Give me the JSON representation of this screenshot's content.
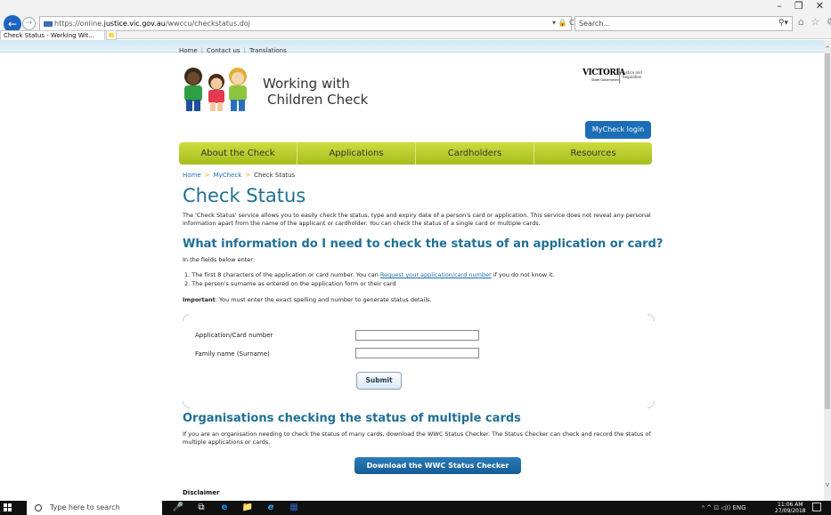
{
  "browser": {
    "url_prefix": "https://online.",
    "url_domain": "justice.vic.gov.au",
    "url_path": "/wwccu/checkstatus.doj",
    "addr_tools": "▾ 🔒 C",
    "search_placeholder": "Search...",
    "tab_title": "Check Status - Working Wit...",
    "window_controls": [
      "–",
      "❐",
      "✕"
    ],
    "toolbar_icons": "⌂ ☆ ⚙ ☺"
  },
  "site": {
    "utility_nav": [
      "Home",
      "Contact us",
      "Translations"
    ],
    "utility_sep": "|",
    "logo_line1": "Working with",
    "logo_line2": "Children Check",
    "vic_word": "VICTORIA",
    "vic_state": "State Government",
    "vic_dept": "Justice and Regulation",
    "mycheck_login": "MyCheck login",
    "main_nav": [
      "About the Check",
      "Applications",
      "Cardholders",
      "Resources"
    ],
    "breadcrumb": [
      "Home",
      "MyCheck",
      "Check Status"
    ],
    "breadcrumb_sep": ">"
  },
  "content": {
    "title": "Check Status",
    "intro": "The 'Check Status' service allows you to easily check the status, type and expiry date of a person's card or application. This service does not reveal any personal information apart from the name of the applicant or cardholder. You can check the status of a single card or multiple cards.",
    "heading_info": "What information do I need to check the status of an application or card?",
    "fields_intro": "In the fields below enter:",
    "step1_pre": "1.  The first 8 characters of the application or card number. You can ",
    "step1_link": "Request your application/card number",
    "step1_post": " if you do not know it.",
    "step2": "2.  The person's surname as entered on the application form or their card",
    "important_label": "Important",
    "important_text": ": You must enter the exact spelling and number to generate status details.",
    "form": {
      "app_label": "Application/Card number",
      "app_value": "",
      "family_label": "Family name (Surname)",
      "family_value": "",
      "submit": "Submit"
    },
    "heading_orgs": "Organisations checking the status of multiple cards",
    "orgs_text": "If you are an organisation needing to check the status of many cards, download the WWC Status Checker. The Status Checker can check and record the status of multiple applications or cards.",
    "download_btn": "Download the WWC Status Checker",
    "disclaimer": "Disclaimer"
  },
  "taskbar": {
    "search_placeholder": "Type here to search",
    "apps": [
      "🎤",
      "⧉",
      "e",
      "📁",
      "e",
      "▦"
    ],
    "tray": "ᴬ  ^  ⊡ ◁)) ENG",
    "time": "11:06 AM",
    "date": "27/09/2018"
  },
  "colors": {
    "accent_blue": "#1f6f95",
    "nav_green": "#b5c92a",
    "button_blue": "#1b6db5"
  }
}
